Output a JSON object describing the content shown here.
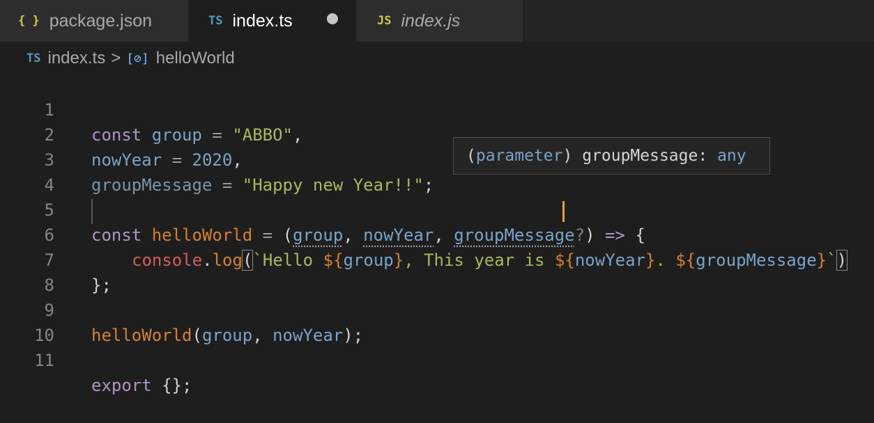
{
  "tabs": [
    {
      "icon": "{ }",
      "label": "package.json",
      "icon_color": "#cbcb41",
      "active": false,
      "italic": false
    },
    {
      "icon": "TS",
      "label": "index.ts",
      "icon_color": "#519aba",
      "active": true,
      "dirty": true,
      "italic": false
    },
    {
      "icon": "JS",
      "label": "index.js",
      "icon_color": "#cbcb41",
      "active": false,
      "italic": true
    }
  ],
  "breadcrumb": {
    "file_icon": "TS",
    "file": "index.ts",
    "separator": ">",
    "symbol_icon": "[⊘]",
    "symbol": "helloWorld"
  },
  "line_numbers": [
    "1",
    "2",
    "3",
    "4",
    "5",
    "6",
    "7",
    "8",
    "9",
    "10",
    "11"
  ],
  "code": {
    "l1": {
      "kw": "const",
      "name": "group",
      "eq": "=",
      "str": "\"ABBO\"",
      "end": ","
    },
    "l2": {
      "name": "nowYear",
      "eq": "=",
      "num": "2020",
      "end": ","
    },
    "l3": {
      "name": "groupMessage",
      "eq": "=",
      "str": "\"Happy new Year!!\"",
      "end": ";"
    },
    "l5": {
      "kw": "const",
      "fn": "helloWorld",
      "eq": "=",
      "open": "(",
      "p1": "group",
      "c1": ",",
      "p2": "nowYear",
      "c2": ",",
      "p3": "groupMessage",
      "q": "?",
      "close": ")",
      "arrow": "=>",
      "brace": "{"
    },
    "l6": {
      "obj": "console",
      "dot": ".",
      "method": "log",
      "open": "(",
      "tick": "`",
      "t1": "Hello ",
      "i1o": "${",
      "i1v": "group",
      "i1c": "}",
      "t2": ", This year is ",
      "i2o": "$",
      "i2b": "{",
      "i2v": "nowYear",
      "i2c": "}",
      "t3": ". ",
      "i3o": "${",
      "i3v": "groupMessage",
      "i3c": "}",
      "tick2": "`",
      "close": ")"
    },
    "l7": {
      "text": "};"
    },
    "l9": {
      "fn": "helloWorld",
      "open": "(",
      "a1": "group",
      "c": ", ",
      "a2": "nowYear",
      "close": ");"
    },
    "l11": {
      "kw": "export",
      "rest": " {};"
    }
  },
  "hover": {
    "open": "(",
    "kind": "parameter",
    "close": ") ",
    "name": "groupMessage",
    "colon": ": ",
    "type": "any"
  }
}
